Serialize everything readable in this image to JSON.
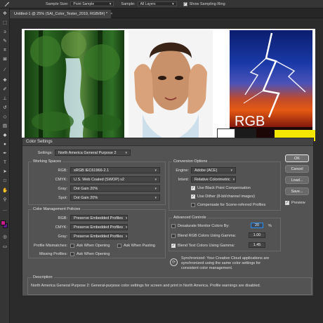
{
  "options_bar": {
    "tool_icon": "eyedropper-icon",
    "sample_size_label": "Sample Size:",
    "sample_size_value": "Point Sample",
    "sample_label": "Sample:",
    "sample_value": "All Layers",
    "sampling_ring_label": "Show Sampling Ring",
    "sampling_ring_checked": true
  },
  "document_tab": {
    "title": "Untitled-1 @ 25% (SAI_Color_Tester_2019, RGB/8#) *",
    "close": "×"
  },
  "canvas": {
    "rgb_text": "RGB",
    "image_icons": [
      "forest-photo",
      "face-splash-photo",
      "lightning-storm-photo"
    ]
  },
  "dialog": {
    "title": "Color Settings",
    "settings_label": "Settings:",
    "settings_value": "North America General Purpose 2",
    "working_spaces": {
      "title": "Working Spaces",
      "rows": [
        {
          "label": "RGB:",
          "value": "sRGB IEC61966-2.1"
        },
        {
          "label": "CMYK:",
          "value": "U.S. Web Coated (SWOP) v2"
        },
        {
          "label": "Gray:",
          "value": "Dot Gain 20%"
        },
        {
          "label": "Spot:",
          "value": "Dot Gain 20%"
        }
      ]
    },
    "conversion": {
      "title": "Conversion Options",
      "engine_label": "Engine:",
      "engine_value": "Adobe (ACE)",
      "intent_label": "Intent:",
      "intent_value": "Relative Colorimetric",
      "black_point": "Use Black Point Compensation",
      "black_point_checked": true,
      "dither": "Use Dither (8-bit/channel images)",
      "dither_checked": true,
      "scene_comp": "Compensate for Scene-referred Profiles",
      "scene_comp_checked": false
    },
    "policies": {
      "title": "Color Management Policies",
      "rows": [
        {
          "label": "RGB:",
          "value": "Preserve Embedded Profiles"
        },
        {
          "label": "CMYK:",
          "value": "Preserve Embedded Profiles"
        },
        {
          "label": "Gray:",
          "value": "Preserve Embedded Profiles"
        }
      ],
      "mismatches_label": "Profile Mismatches:",
      "ask_opening": "Ask When Opening",
      "ask_pasting": "Ask When Pasting",
      "missing_label": "Missing Profiles:",
      "missing_ask": "Ask When Opening"
    },
    "advanced": {
      "title": "Advanced Controls",
      "desaturate": "Desaturate Monitor Colors By:",
      "desaturate_checked": false,
      "desaturate_value": "20",
      "desaturate_unit": "%",
      "blend_rgb": "Blend RGB Colors Using Gamma:",
      "blend_rgb_checked": false,
      "blend_rgb_value": "1.00",
      "blend_text": "Blend Text Colors Using Gamma:",
      "blend_text_checked": true,
      "blend_text_value": "1.45"
    },
    "sync_message_line1": "Synchronized: Your Creative Cloud applications are",
    "sync_message_line2": "synchronized using the same color settings for",
    "sync_message_line3": "consistent color management.",
    "description_title": "Description",
    "description_text": "North America General Purpose 2:  General-purpose color settings for screen and print in North America. Profile warnings are disabled.",
    "buttons": {
      "ok": "OK",
      "cancel": "Cancel",
      "load": "Load...",
      "save": "Save..."
    },
    "preview_label": "Preview",
    "preview_checked": true
  }
}
